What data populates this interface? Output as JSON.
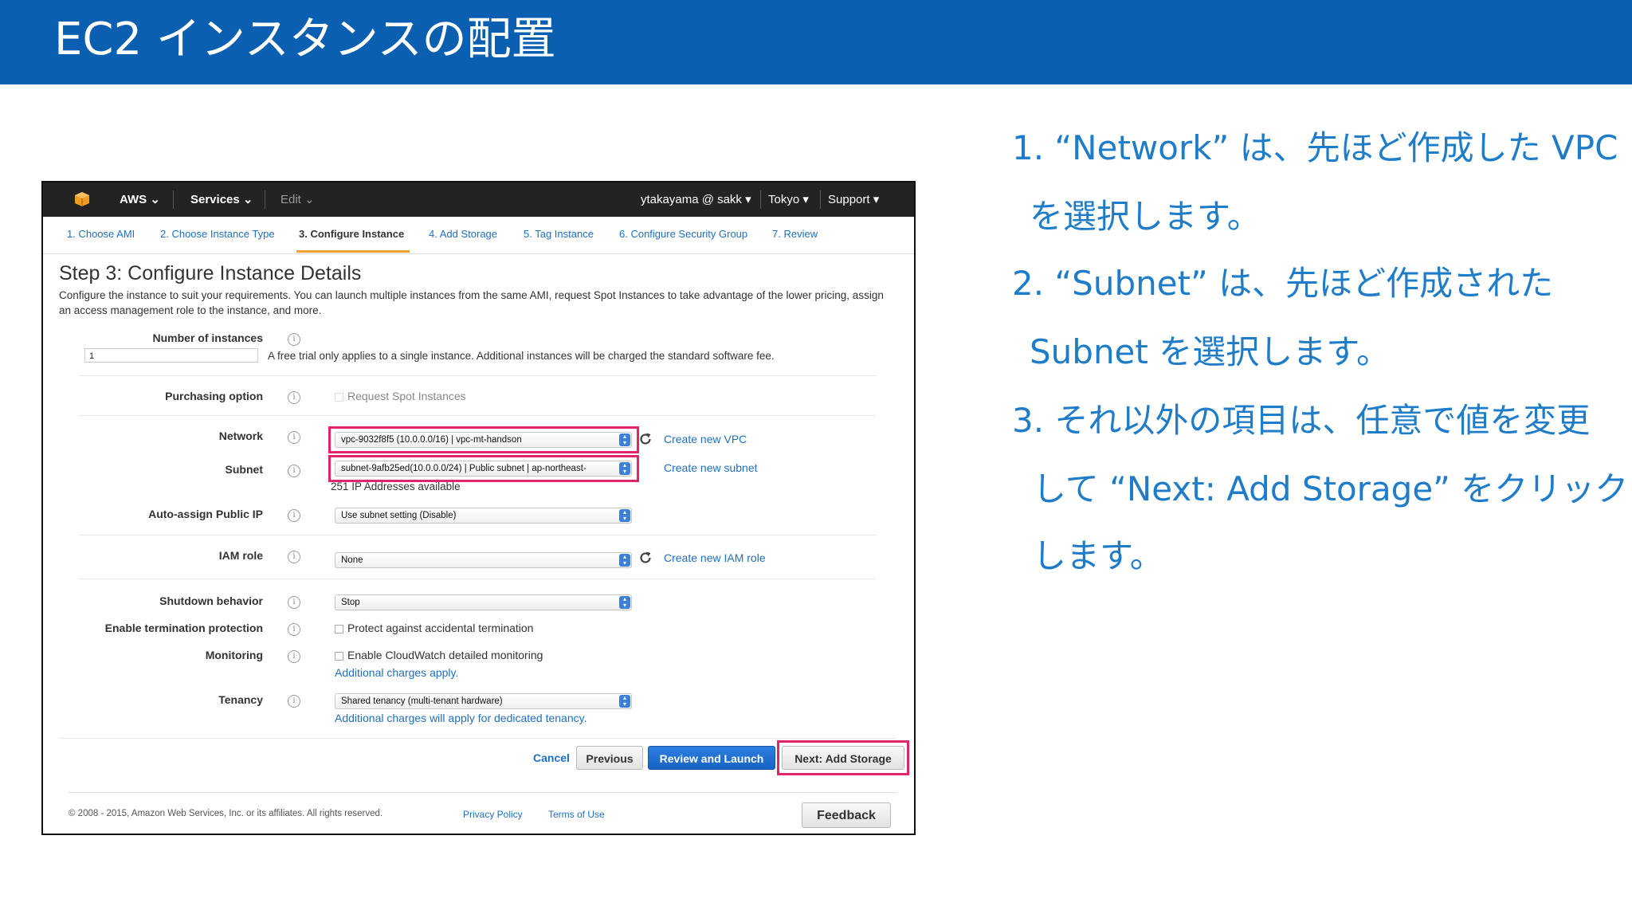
{
  "slide": {
    "title": "EC2 インスタンスの配置",
    "notes": [
      "1. “Network” は、先ほど作成した VPC",
      "を選択します。",
      "2. “Subnet” は、先ほど作成された",
      "Subnet を選択します。",
      "3. それ以外の項目は、任意で値を変更",
      "して “Next: Add Storage” をクリック",
      "します。"
    ]
  },
  "console": {
    "nav": {
      "aws": "AWS ⌄",
      "services": "Services ⌄",
      "edit": "Edit ⌄",
      "user": "ytakayama @ sakk ▾",
      "region": "Tokyo ▾",
      "support": "Support ▾"
    },
    "steps": [
      "1. Choose AMI",
      "2. Choose Instance Type",
      "3. Configure Instance",
      "4. Add Storage",
      "5. Tag Instance",
      "6. Configure Security Group",
      "7. Review"
    ],
    "active_step": 2,
    "page_title": "Step 3: Configure Instance Details",
    "page_desc": "Configure the instance to suit your requirements. You can launch multiple instances from the same AMI, request Spot Instances to take advantage of the lower pricing, assign an access management role to the instance, and more.",
    "form": {
      "num_instances_label": "Number of instances",
      "num_instances_value": "1",
      "num_instances_note": "A free trial only applies to a single instance. Additional instances will be charged the standard software fee.",
      "purchasing_label": "Purchasing option",
      "purchasing_checkbox": "Request Spot Instances",
      "network_label": "Network",
      "network_value": "vpc-9032f8f5 (10.0.0.0/16) | vpc-mt-handson",
      "create_vpc": "Create new VPC",
      "subnet_label": "Subnet",
      "subnet_value": "subnet-9afb25ed(10.0.0.0/24) | Public subnet | ap-northeast-",
      "create_subnet": "Create new subnet",
      "subnet_ips": "251 IP Addresses available",
      "public_ip_label": "Auto-assign Public IP",
      "public_ip_value": "Use subnet setting (Disable)",
      "iam_label": "IAM role",
      "iam_value": "None",
      "create_iam": "Create new IAM role",
      "shutdown_label": "Shutdown behavior",
      "shutdown_value": "Stop",
      "termination_label": "Enable termination protection",
      "termination_checkbox": "Protect against accidental termination",
      "monitoring_label": "Monitoring",
      "monitoring_checkbox": "Enable CloudWatch detailed monitoring",
      "monitoring_link": "Additional charges apply.",
      "tenancy_label": "Tenancy",
      "tenancy_value": "Shared tenancy (multi-tenant hardware)",
      "tenancy_link": "Additional charges will apply for dedicated tenancy."
    },
    "buttons": {
      "cancel": "Cancel",
      "previous": "Previous",
      "review": "Review and Launch",
      "next": "Next: Add Storage"
    },
    "footer": {
      "copyright": "© 2008 - 2015, Amazon Web Services, Inc. or its affiliates. All rights reserved.",
      "privacy": "Privacy Policy",
      "terms": "Terms of Use",
      "feedback": "Feedback"
    },
    "colors": {
      "highlight": "#e0256a",
      "link": "#1f6fbf",
      "primary_button": "#1763c4",
      "header": "#0a5fb0"
    }
  }
}
